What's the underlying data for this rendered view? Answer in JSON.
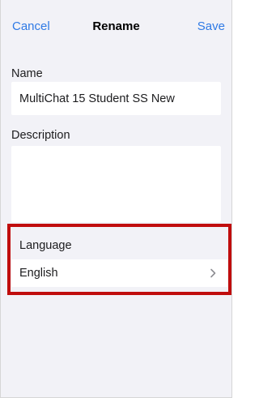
{
  "nav": {
    "cancel_label": "Cancel",
    "title": "Rename",
    "save_label": "Save"
  },
  "form": {
    "name_label": "Name",
    "name_value": "MultiChat 15 Student SS New",
    "description_label": "Description",
    "description_value": "",
    "language_label": "Language",
    "language_value": "English"
  },
  "icons": {
    "language_chevron": "chevron-right-icon"
  },
  "colors": {
    "accent": "#2f7ae5",
    "highlight": "#c00d0d",
    "background": "#f2f2f7"
  }
}
